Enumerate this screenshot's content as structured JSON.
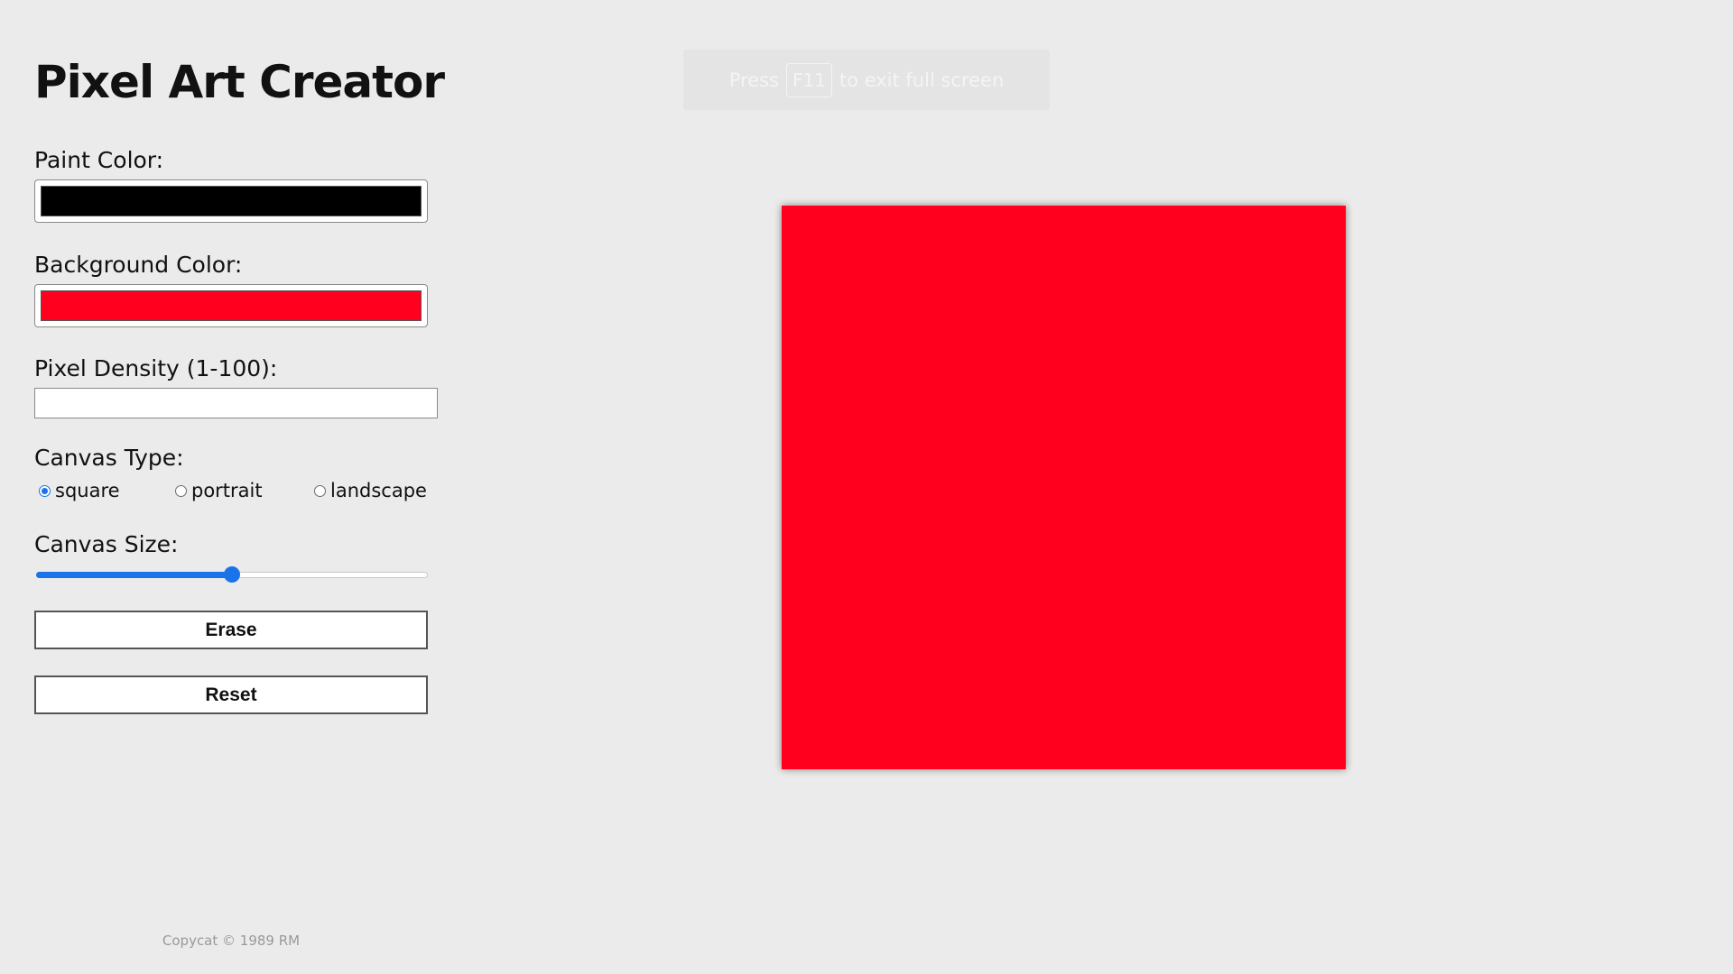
{
  "app": {
    "title": "Pixel Art Creator"
  },
  "controls": {
    "paint_color_label": "Paint Color:",
    "paint_color": "#000000",
    "background_color_label": "Background Color:",
    "background_color": "#ff001e",
    "pixel_density_label": "Pixel Density (1-100):",
    "pixel_density_value": "",
    "canvas_type_label": "Canvas Type:",
    "canvas_type_options": [
      {
        "label": "square",
        "checked": true
      },
      {
        "label": "portrait",
        "checked": false
      },
      {
        "label": "landscape",
        "checked": false
      }
    ],
    "canvas_size_label": "Canvas Size:",
    "canvas_size_fraction": 0.5,
    "erase_label": "Erase",
    "reset_label": "Reset"
  },
  "footer": {
    "text": "Copycat © 1989 RM"
  },
  "fullscreen_notice": {
    "prefix": "Press",
    "key": "F11",
    "suffix": "to exit full screen"
  },
  "canvas": {
    "fill_color": "#ff001e"
  },
  "colors": {
    "page_background": "#ebebeb",
    "accent": "#1a73e8"
  }
}
